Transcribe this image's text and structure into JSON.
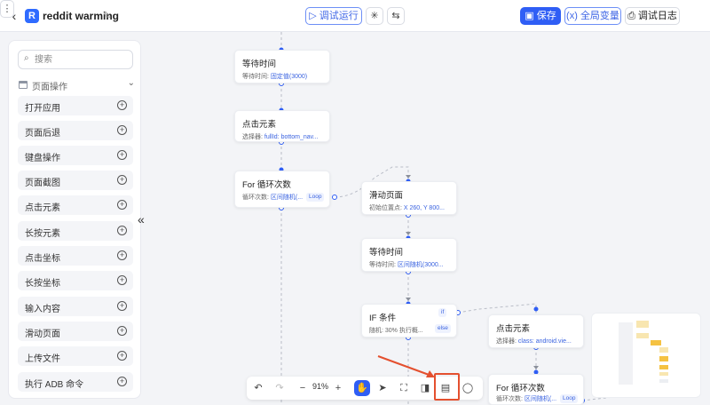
{
  "header": {
    "back_icon": "chevron-left-icon",
    "logo_letter": "R",
    "title": "reddit warming",
    "run_label": "调试运行",
    "save_label": "保存",
    "global_vars_label": "全局变量",
    "debug_log_label": "调试日志"
  },
  "sidebar": {
    "search_placeholder": "搜索",
    "group_label": "页面操作",
    "items": [
      {
        "label": "打开应用"
      },
      {
        "label": "页面后退"
      },
      {
        "label": "键盘操作"
      },
      {
        "label": "页面截图"
      },
      {
        "label": "点击元素"
      },
      {
        "label": "长按元素"
      },
      {
        "label": "点击坐标"
      },
      {
        "label": "长按坐标"
      },
      {
        "label": "输入内容"
      },
      {
        "label": "滑动页面"
      },
      {
        "label": "上传文件"
      },
      {
        "label": "执行 ADB 命令"
      }
    ],
    "collapse_glyph": "«"
  },
  "nodes": {
    "wait1": {
      "title": "等待时间",
      "sub_label": "等待时间: ",
      "sub_value": "固定值(3000)"
    },
    "click1": {
      "title": "点击元素",
      "sub_label": "选择器: ",
      "sub_value": "fullId: bottom_nav..."
    },
    "loop1": {
      "title": "For 循环次数",
      "sub_label": "循环次数: ",
      "sub_value": "区间随机(...",
      "tag": "Loop"
    },
    "swipe": {
      "title": "滑动页面",
      "sub_label": "初始位置点: ",
      "sub_value": "X 260, Y 800..."
    },
    "wait2": {
      "title": "等待时间",
      "sub_label": "等待时间: ",
      "sub_value": "区间随机(3000..."
    },
    "ifcond": {
      "title": "IF 条件",
      "sub_label": "随机: 30%  执行概...",
      "tag_if": "if",
      "tag_else": "else"
    },
    "click2": {
      "title": "点击元素",
      "sub_label": "选择器: ",
      "sub_value": "class: android.vie..."
    },
    "loop2": {
      "title": "For 循环次数",
      "sub_label": "循环次数: ",
      "sub_value": "区间随机(...",
      "tag": "Loop"
    }
  },
  "toolbar": {
    "zoom": "91%",
    "undo_icon": "undo-icon",
    "redo_icon": "redo-icon",
    "hand_icon": "hand-icon",
    "select_icon": "cursor-icon",
    "fit_icon": "fit-view-icon",
    "node_icon": "add-node-icon",
    "align_icon": "align-left-icon",
    "comment_icon": "comment-icon"
  },
  "colors": {
    "accent": "#2f5ef5",
    "node_value": "#3a63e0",
    "highlight": "#e4502f"
  }
}
